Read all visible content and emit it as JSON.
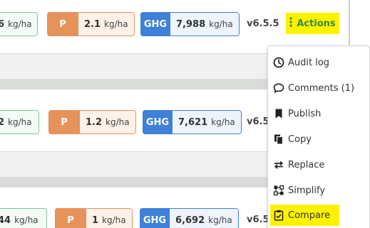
{
  "rows": [
    {
      "green_value": "6",
      "green_unit": "kg/ha",
      "p_label": "P",
      "p_value": "2.1",
      "p_unit": "kg/ha",
      "ghg_label": "GHG",
      "ghg_value": "7,988",
      "ghg_unit": "kg/ha",
      "version": "v6.5.5"
    },
    {
      "green_value": "2",
      "green_unit": "kg/ha",
      "p_label": "P",
      "p_value": "1.2",
      "p_unit": "kg/ha",
      "ghg_label": "GHG",
      "ghg_value": "7,621",
      "ghg_unit": "kg/ha",
      "version": "v6.5."
    },
    {
      "green_value": "44",
      "green_unit": "kg/ha",
      "p_label": "P",
      "p_value": "1",
      "p_unit": "kg/ha",
      "ghg_label": "GHG",
      "ghg_value": "6,692",
      "ghg_unit": "kg/ha",
      "version": "v6.5."
    }
  ],
  "actions": {
    "label": "Actions",
    "icon": "vertical-dots-icon"
  },
  "menu": {
    "items": [
      {
        "label": "Audit log",
        "icon": "clock-icon"
      },
      {
        "label": "Comments (1)",
        "icon": "speech-bubble-icon"
      },
      {
        "label": "Publish",
        "icon": "bookmark-icon"
      },
      {
        "label": "Copy",
        "icon": "copy-icon"
      },
      {
        "label": "Replace",
        "icon": "swap-arrows-icon"
      },
      {
        "label": "Simplify",
        "icon": "simplify-icon"
      },
      {
        "label": "Compare",
        "icon": "clipboard-check-icon"
      }
    ]
  },
  "colors": {
    "green": "#7cc39a",
    "orange": "#e5935a",
    "blue": "#3f80d8",
    "highlight": "#fff200",
    "actions_text": "#2e8b3e"
  }
}
